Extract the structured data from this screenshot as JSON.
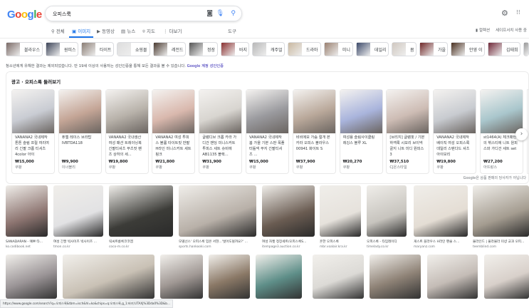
{
  "header": {
    "logo": "Google",
    "query": "오피스룩"
  },
  "tabs": [
    {
      "label": "전체",
      "icon": "search-icon"
    },
    {
      "label": "이미지",
      "icon": "image-icon",
      "active": true
    },
    {
      "label": "동영상",
      "icon": "play-icon"
    },
    {
      "label": "뉴스",
      "icon": "news-icon"
    },
    {
      "label": "지도",
      "icon": "pin-icon"
    },
    {
      "label": "더보기",
      "icon": "more-icon"
    }
  ],
  "tools": "도구",
  "collections": "컬렉션",
  "safesearch": "세이프서치 사용 중",
  "chips": [
    "블라우스",
    "원피스",
    "타이트",
    "쇼핑몰",
    "레전드",
    "정장",
    "바지",
    "캐주얼",
    "드라마",
    "미니",
    "데일리",
    "봄",
    "가을",
    "안영 이",
    "김태희"
  ],
  "notice": {
    "text": "청소년에게 유해한 결과는 제외되었습니다. 만 19세 이상의 사용자는 성인인증을 통해 모든 결과를 볼 수 있습니다.",
    "link": "Google 계정 성인인증"
  },
  "ads": {
    "title": "광고 · 오피스룩 둘러보기",
    "disclaimer": "Google은 상품 판매의 당사자가 아닙니다",
    "items": [
      {
        "title": "VANANA2 국내제작 톤톤 슬림 프릴 여리여리 긴팔 크롭 티셔츠 4color 아이",
        "price": "₩15,000",
        "seller": "쿠팡",
        "color": "#c9ccd3"
      },
      {
        "title": "퓨엘 레이스 브라탑 IVBTDA118",
        "price": "₩9,900",
        "seller": "이너블리",
        "color": "#c4a596"
      },
      {
        "title": "VANANA2 국내생산 여성 패션 트레이닝복 긴팔티셔츠 부츠컷 팬츠 상하의 세...",
        "price": "₩19,800",
        "seller": "쿠팡",
        "color": "#b8b2aa"
      },
      {
        "title": "VANANA2 여성 투피스 볼륨 타이트핏 반팔 H라인 미니스커트 세트 핑크",
        "price": "₩21,800",
        "seller": "쿠팡",
        "color": "#d9b8ad"
      },
      {
        "title": "글램디브 크롭 카라 가디건 밴딩 미니스커트 투피스 세트 슈비에 AB1135 블랙...",
        "price": "₩31,900",
        "seller": "쿠팡",
        "color": "#d8d5d0"
      },
      {
        "title": "VANANA2 국내제작 봄 가을 기본 스판 폭폴 터틀넥 무지 긴팔티셔츠 ...",
        "price": "₩15,000",
        "seller": "쿠팡",
        "color": "#9a9a9e"
      },
      {
        "title": "비비에모 가슴 절개 본 카라 오피스 블라우스 00941 화이트 S",
        "price": "₩37,900",
        "seller": "쿠팡",
        "color": "#b9a89a"
      },
      {
        "title": "여성용 슬림사이클링 레깅스 블루 XL",
        "price": "₩20,270",
        "seller": "쿠팡",
        "color": "#a9b4dc"
      },
      {
        "title": "[브리지] 글램핏 / 기본 하객룩 시보리 브이넥 골지 니트 미디 원피스 3",
        "price": "₩37,510",
        "seller": "CJ온스타일",
        "color": "#cdbcb4"
      },
      {
        "title": "VANANA2 국내제작 베이직 여성 오피스룩 데일리 스탠다드 셔츠 아이보리",
        "price": "₩19,800",
        "seller": "쿠팡",
        "color": "#c8cbd0"
      },
      {
        "title": "st1464(A) 체크패턴의 뷔스티에 니트 원피스와 가디건 세트 set",
        "price": "₩27,200",
        "seller": "아뜨랑스",
        "color": "#a9c6cc"
      }
    ]
  },
  "images_row1": [
    {
      "caption": "SANADARAN - 예쁘 타...",
      "source": "ko.codibook.net",
      "color": "#8c7470"
    },
    {
      "caption": "여성 긴팔 빅사이즈 빅사이즈 ...",
      "source": "tmon.co.kr",
      "color": "#e2e2e4"
    },
    {
      "caption": "릭씨트룸룩코코엠",
      "source": "coco-m.co.kr",
      "color": "#3c3c38"
    },
    {
      "caption": "모델선스' 오피스룩 입은 서현...'벗어도될까요?' ...",
      "source": "sports.hankooki.com",
      "color": "#b8b0a8"
    },
    {
      "caption": "여성 자켓 정장세트/오피스룩S...",
      "source": "itempage3.auction.co.kr",
      "color": "#6a5c52"
    },
    {
      "caption": "흔한 오피스룩",
      "source": "mbr.voalair.kra.kr",
      "color": "#e6e2dc"
    },
    {
      "caption": "오피스룩 - 타임레이디",
      "source": "timelady.co.kr",
      "color": "#c7c4be"
    },
    {
      "caption": "게스트 블라우스 H라인 펜슬 스...",
      "source": "maryanz.com",
      "color": "#e4ddd4"
    },
    {
      "caption": "물라인드 | 물라물라 미샹 교과 오피...",
      "source": "teemblind.com",
      "color": "#a49c90"
    }
  ],
  "images_row2": [
    {
      "color": "#9a9496"
    },
    {
      "color": "#c9c1b5"
    },
    {
      "color": "#a09894"
    },
    {
      "color": "#8a7866"
    },
    {
      "color": "#5e8e88"
    },
    {
      "color": "#dcdad6"
    },
    {
      "color": "#8e8276"
    },
    {
      "color": "#c4bcb6"
    },
    {
      "color": "#d8d0ca"
    }
  ],
  "status_url": "https://www.google.com/search?q=오피스룩&tbm=isch&hl=ko&chips=q:오피스룩,g_1:바지:UTAXj%3Dda0%3D&b..."
}
